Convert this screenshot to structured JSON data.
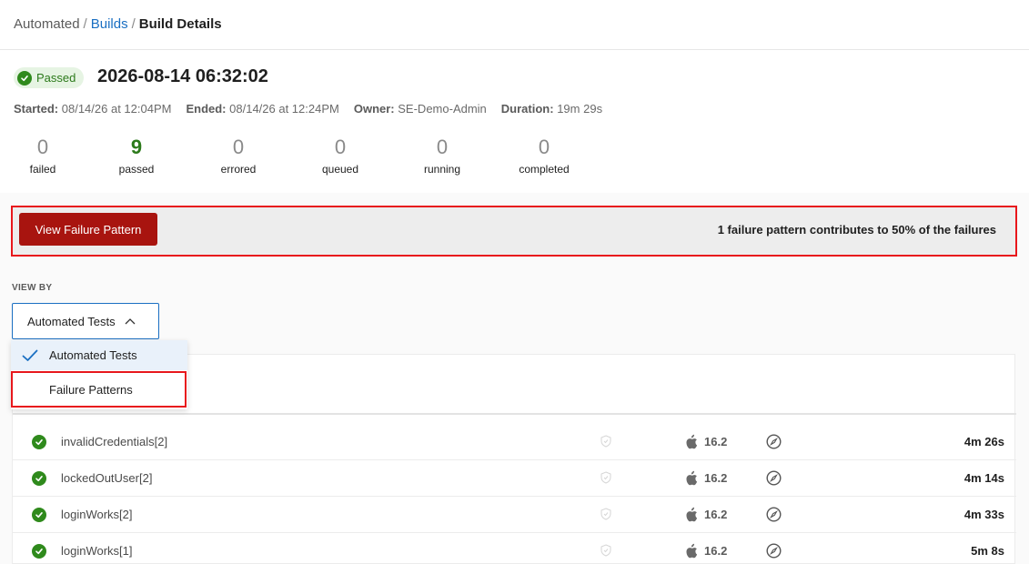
{
  "breadcrumb": {
    "root": "Automated",
    "parent": "Builds",
    "current": "Build Details",
    "sep": "/"
  },
  "build": {
    "status": "Passed",
    "title": "2026-08-14 06:32:02",
    "meta": [
      {
        "label": "Started:",
        "value": "08/14/26 at 12:04PM"
      },
      {
        "label": "Ended:",
        "value": "08/14/26 at 12:24PM"
      },
      {
        "label": "Owner:",
        "value": "SE-Demo-Admin"
      },
      {
        "label": "Duration:",
        "value": "19m 29s"
      }
    ],
    "stats": [
      {
        "num": "0",
        "label": "failed"
      },
      {
        "num": "9",
        "label": "passed"
      },
      {
        "num": "0",
        "label": "errored"
      },
      {
        "num": "0",
        "label": "queued"
      },
      {
        "num": "0",
        "label": "running"
      },
      {
        "num": "0",
        "label": "completed"
      }
    ]
  },
  "failure_bar": {
    "button_label": "View Failure Pattern",
    "message": "1 failure pattern contributes to 50% of the failures"
  },
  "view_by": {
    "label": "VIEW BY",
    "selected": "Automated Tests",
    "options": [
      "Automated Tests",
      "Failure Patterns"
    ]
  },
  "tests": [
    {
      "name": "invalidCredentials[2]",
      "os_version": "16.2",
      "duration": "4m 26s"
    },
    {
      "name": "lockedOutUser[2]",
      "os_version": "16.2",
      "duration": "4m 14s"
    },
    {
      "name": "loginWorks[2]",
      "os_version": "16.2",
      "duration": "4m 33s"
    },
    {
      "name": "loginWorks[1]",
      "os_version": "16.2",
      "duration": "5m 8s"
    }
  ],
  "colors": {
    "accent_blue": "#1a6fc2",
    "pass_green": "#2f8a1c",
    "danger_red": "#a8140f",
    "highlight_red": "#e8171c"
  }
}
